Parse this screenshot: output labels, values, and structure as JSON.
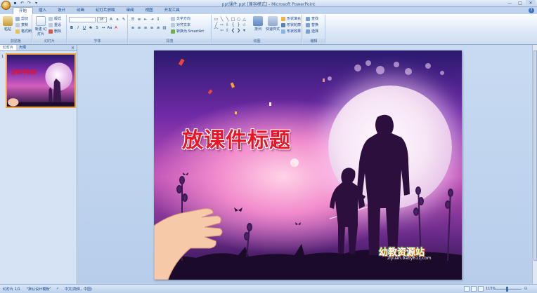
{
  "window": {
    "title": "ppt课件.ppt [兼容模式] - Microsoft PowerPoint"
  },
  "ribbon_tabs": [
    "开始",
    "插入",
    "设计",
    "动画",
    "幻灯片放映",
    "审阅",
    "视图",
    "开发工具"
  ],
  "ribbon": {
    "clipboard": {
      "group_label": "剪贴板",
      "paste": "粘贴",
      "cut": "剪切",
      "copy": "复制",
      "format_painter": "格式刷"
    },
    "slides": {
      "group_label": "幻灯片",
      "new_slide": "新建\n幻灯片",
      "layout": "版式",
      "reset": "重设",
      "delete": "删除"
    },
    "font": {
      "group_label": "字体",
      "font_size": "18"
    },
    "paragraph": {
      "group_label": "段落",
      "text_direction": "文字方向",
      "align_text": "对齐文本",
      "smartart": "转换为 SmartArt"
    },
    "drawing": {
      "group_label": "绘图",
      "arrange": "排列",
      "quick_styles": "快速样式",
      "shape_fill": "形状填充",
      "shape_outline": "形状轮廓",
      "shape_effects": "形状效果"
    },
    "editing": {
      "group_label": "编辑",
      "find": "查找",
      "replace": "替换",
      "select": "选择"
    }
  },
  "left_pane": {
    "tabs": [
      "幻灯片",
      "大纲"
    ],
    "slide_number": "1",
    "thumbnail_title": "放课件标题"
  },
  "slide": {
    "title": "放课件标题",
    "logo_text": "幼教资源站",
    "logo_url": "ziyuan.baby611.com"
  },
  "status_bar": {
    "slide_info": "幻灯片 1/1",
    "theme": "\"默认设计模板\"",
    "language": "中文(简体，中国)",
    "zoom": "115%"
  }
}
